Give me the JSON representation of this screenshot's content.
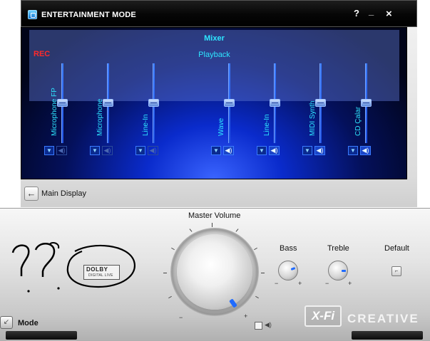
{
  "window": {
    "title": "ENTERTAINMENT MODE",
    "help": "?",
    "minimize": "_",
    "close": "×"
  },
  "mixer": {
    "title": "Mixer",
    "subtitle": "Playback",
    "rec_label": "REC",
    "channels": [
      {
        "label": "Microphone FP",
        "muted": true
      },
      {
        "label": "Microphone",
        "muted": true
      },
      {
        "label": "Line-In",
        "muted": true
      },
      {
        "label": "Wave",
        "muted": false
      },
      {
        "label": "Line-In",
        "muted": false
      },
      {
        "label": "MIDI Synth",
        "muted": false
      },
      {
        "label": "CD Çalar",
        "muted": false
      }
    ]
  },
  "nav": {
    "main_display": "Main Display"
  },
  "console": {
    "master_volume": "Master Volume",
    "bass": "Bass",
    "treble": "Treble",
    "default": "Default",
    "mode": "Mode",
    "dolby": {
      "main": "DOLBY",
      "sub": "DIGITAL LIVE"
    },
    "brand_xfi": "X-Fi",
    "brand_creative": "CREATIVE",
    "minus": "−",
    "plus": "+"
  },
  "colors": {
    "mixer_text": "#2ee6ff",
    "rec": "#ff2a2a",
    "accent": "#1f6bff"
  }
}
